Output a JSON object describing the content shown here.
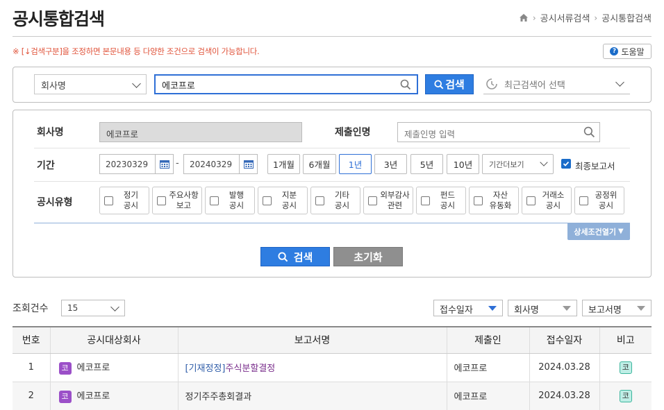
{
  "page_title": "공시통합검색",
  "breadcrumb": [
    "공시서류검색",
    "공시통합검색"
  ],
  "notice": "※ [↓검색구분]을 조정하면 본문내용 등 다양한 조건으로 검색이 가능합니다.",
  "help_label": "도움말",
  "quick_search": {
    "type_value": "회사명",
    "query_value": "에코프로",
    "search_label": "검색",
    "recent_placeholder": "최근검색어 선택"
  },
  "detail_form": {
    "company_label": "회사명",
    "company_value": "에코프로",
    "submitter_label": "제출인명",
    "submitter_placeholder": "제출인명 입력",
    "period_label": "기간",
    "date_from": "20230329",
    "date_sep": "-",
    "date_to": "20240329",
    "period_buttons": [
      "1개월",
      "6개월",
      "1년",
      "3년",
      "5년",
      "10년"
    ],
    "period_active": "1년",
    "period_select": "기간더보기",
    "final_report_label": "최종보고서",
    "final_report_checked": true,
    "type_label": "공시유형",
    "types": [
      "정기\n공시",
      "주요사항\n보고",
      "발행\n공시",
      "지분\n공시",
      "기타\n공시",
      "외부감사\n관련",
      "펀드\n공시",
      "자산\n유동화",
      "거래소\n공시",
      "공정위\n공시"
    ],
    "detail_toggle": "상세조건열기",
    "search_label": "검색",
    "reset_label": "초기화"
  },
  "results": {
    "count_label": "조회건수",
    "count_value": "15",
    "sort_options": [
      "접수일자",
      "회사명",
      "보고서명"
    ],
    "columns": [
      "번호",
      "공시대상회사",
      "보고서명",
      "제출인",
      "접수일자",
      "비고"
    ],
    "rows": [
      {
        "no": "1",
        "badge": "코",
        "company": "에코프로",
        "report_prefix": "[기재정정]",
        "report": "주식분할결정",
        "submitter": "에코프로",
        "date": "2024.03.28",
        "note": "코"
      },
      {
        "no": "2",
        "badge": "코",
        "company": "에코프로",
        "report_prefix": "",
        "report": "정기주주총회결과",
        "submitter": "에코프로",
        "date": "2024.03.28",
        "note": "코"
      }
    ]
  },
  "colors": {
    "accent": "#2e7de1",
    "notice": "#e0533a",
    "badge": "#9b4fc8",
    "note_badge": "#bfeee6"
  }
}
